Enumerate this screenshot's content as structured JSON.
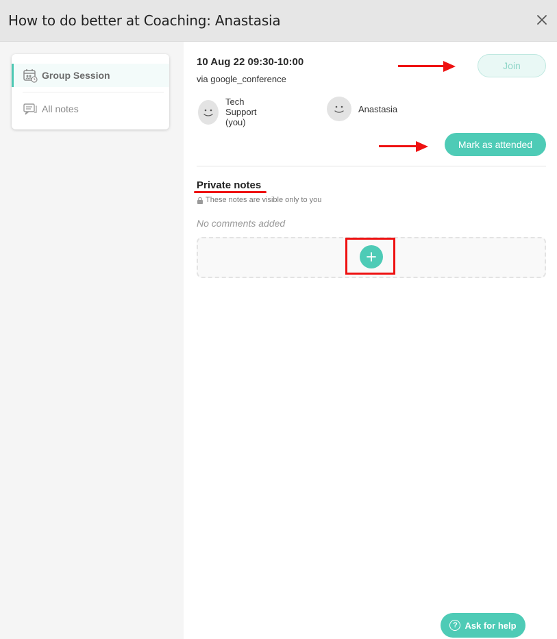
{
  "modal": {
    "title": "How to do better at Coaching: Anastasia",
    "close_icon": "close-icon"
  },
  "sidebar": {
    "items": [
      {
        "label": "Group Session",
        "icon": "calendar-group-icon",
        "active": true
      },
      {
        "label": "All notes",
        "icon": "notes-icon",
        "active": false
      }
    ]
  },
  "session": {
    "datetime": "10 Aug 22 09:30-10:00",
    "via": "via google_conference",
    "join_label": "Join",
    "mark_attended_label": "Mark as attended",
    "participants": [
      {
        "name": "Tech Support (you)",
        "avatar": "smiley-avatar-icon"
      },
      {
        "name": "Anastasia",
        "avatar": "smiley-avatar-icon"
      }
    ]
  },
  "notes": {
    "title": "Private notes",
    "visibility": "These notes are visible only to you",
    "empty_text": "No comments added",
    "add_icon": "plus-icon"
  },
  "help": {
    "label": "Ask for help",
    "icon": "question-circle-icon"
  },
  "colors": {
    "accent": "#4ecbb6",
    "annotation": "#ee1111",
    "sidebar_bg": "#f5f5f5",
    "titlebar_bg": "#e6e6e6"
  }
}
